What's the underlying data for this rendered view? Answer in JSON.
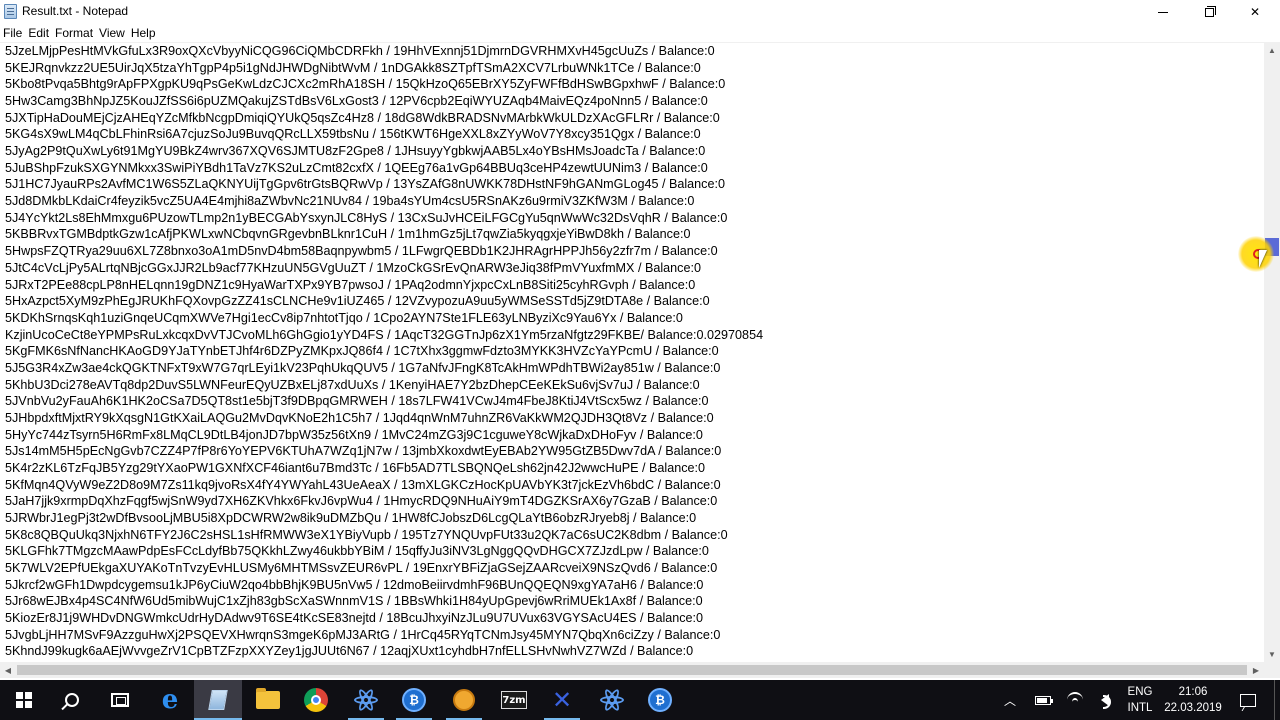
{
  "window": {
    "title": "Result.txt - Notepad"
  },
  "menu": [
    "File",
    "Edit",
    "Format",
    "View",
    "Help"
  ],
  "lines": [
    "5JzeLMjpPesHtMVkGfuLx3R9oxQXcVbyyNiCQG96CiQMbCDRFkh / 19HhVExnnj51DjmrnDGVRHMXvH45gcUuZs / Balance:0",
    "5KEJRqnvkzz2UE5UirJqX5tzaYhTgpP4p5i1gNdJHWDgNibtWvM / 1nDGAkk8SZTpfTSmA2XCV7LrbuWNk1TCe / Balance:0",
    "5Kbo8tPvqa5Bhtg9rApFPXgpKU9qPsGeKwLdzCJCXc2mRhA18SH / 15QkHzoQ65EBrXY5ZyFWFfBdHSwBGpxhwF / Balance:0",
    "5Hw3Camg3BhNpJZ5KouJZfSS6i6pUZMQakujZSTdBsV6LxGost3 / 12PV6cpb2EqiWYUZAqb4MaivEQz4poNnn5 / Balance:0",
    "5JXTipHaDouMEjCjzAHEqYZcMfkbNcgpDmiqiQYUkQ5qsZc4Hz8 / 18dG8WdkBRADSNvMArbkWkULDzXAcGFLRr / Balance:0",
    "5KG4sX9wLM4qCbLFhinRsi6A7cjuzSoJu9BuvqQRcLLX59tbsNu / 156tKWT6HgeXXL8xZYyWoV7Y8xcy351Qgx / Balance:0",
    "5JyAg2P9tQuXwLy6t91MgYU9BkZ4wrv367XQV6SJMTU8zF2Gpe8 / 1JHsuyyYgbkwjAAB5Lx4oYBsHMsJoadcTa / Balance:0",
    "5JuBShpFzukSXGYNMkxx3SwiPiYBdh1TaVz7KS2uLzCmt82cxfX / 1QEEg76a1vGp64BBUq3ceHP4zewtUUNim3 / Balance:0",
    "5J1HC7JyauRPs2AvfMC1W6S5ZLaQKNYUijTgGpv6trGtsBQRwVp / 13YsZAfG8nUWKK78DHstNF9hGANmGLog45 / Balance:0",
    "5Jd8DMkbLKdaiCr4feyzik5vcZ5UA4E4mjhi8aZWbvNc21NUv84 / 19ba4sYUm4csU5RSnAKz6u9rmiV3ZKfW3M / Balance:0",
    "5J4YcYkt2Ls8EhMmxgu6PUzowTLmp2n1yBECGAbYsxynJLC8HyS / 13CxSuJvHCEiLFGCgYu5qnWwWc32DsVqhR / Balance:0",
    "5KBBRvxTGMBdptkGzw1cAfjPKWLxwNCbqvnGRgevbnBLknr1CuH / 1m1hmGz5jLt7qwZia5kyqgxjeYiBwD8kh / Balance:0",
    "5HwpsFZQTRya29uu6XL7Z8bnxo3oA1mD5nvD4bm58Baqnpywbm5 / 1LFwgrQEBDb1K2JHRAgrHPPJh56y2zfr7m / Balance:0",
    "5JtC4cVcLjPy5ALrtqNBjcGGxJJR2Lb9acf77KHzuUN5GVgUuZT / 1MzoCkGSrEvQnARW3eJiq38fPmVYuxfmMX / Balance:0",
    "5JRxT2PEe88cpLP8nHELqnn19gDNZ1c9HyaWarTXPx9YB7pwsoJ / 1PAq2odmnYjxpcCxLnB8Siti25cyhRGvph / Balance:0",
    "5HxAzpct5XyM9zPhEgJRUKhFQXovpGzZZ41sCLNCHe9v1iUZ465 / 12VZvypozuA9uu5yWMSeSSTd5jZ9tDTA8e / Balance:0",
    "5KDKhSrnqsKqh1uziGnqeUCqmXWVe7Hgi1ecCv8ip7nhtotTjqo / 1Cpo2AYN7Ste1FLE63yLNByziXc9Yau6Yx / Balance:0",
    "KzjinUcoCeCt8eYPMPsRuLxkcqxDvVTJCvoMLh6GhGgio1yYD4FS / 1AqcT32GGTnJp6zX1Ym5rzaNfgtz29FKBE/ Balance:0.02970854",
    "5KgFMK6sNfNancHKAoGD9YJaTYnbETJhf4r6DZPyZMKpxJQ86f4 / 1C7tXhx3ggmwFdzto3MYKK3HVZcYaYPcmU / Balance:0",
    "5J5G3R4xZw3ae4ckQGKTNFxT9xW7G7qrLEyi1kV23PqhUkqQUV5 / 1G7aNfvJFngK8TcAkHmWPdhTBWi2ay851w / Balance:0",
    "5KhbU3Dci278eAVTq8dp2DuvS5LWNFeurEQyUZBxELj87xdUuXs / 1KenyiHAE7Y2bzDhepCEeKEkSu6vjSv7uJ / Balance:0",
    "5JVnbVu2yFauAh6K1HK2oCSa7D5QT8st1e5bjT3f9DBpqGMRWEH / 18s7LFW41VCwJ4m4FbeJ8KtiJ4VtScx5wz / Balance:0",
    "5JHbpdxftMjxtRY9kXqsgN1GtKXaiLAQGu2MvDqvKNoE2h1C5h7 / 1Jqd4qnWnM7uhnZR6VaKkWM2QJDH3Qt8Vz / Balance:0",
    "5HyYc744zTsyrn5H6RmFx8LMqCL9DtLB4jonJD7bpW35z56tXn9 / 1MvC24mZG3j9C1cguweY8cWjkaDxDHoFyv / Balance:0",
    "5Js14mM5H5pEcNgGvb7CZZ4P7fP8r6YoYEPV6KTUhA7WZq1jN7w / 13jmbXkoxdwtEyEBAb2YW95GtZB5Dwv7dA / Balance:0",
    "5K4r2zKL6TzFqJB5Yzg29tYXaoPW1GXNfXCF46iant6u7Bmd3Tc / 16Fb5AD7TLSBQNQeLsh62jn42J2wwcHuPE / Balance:0",
    "5KfMqn4QVyW9eZ2D8o9M7Zs11kq9jvoRsX4fY4YWYahL43UeAeaX / 13mXLGKCzHocKpUAVbYK3t7jckEzVh6bdC / Balance:0",
    "5JaH7jjk9xrmpDqXhzFqgf5wjSnW9yd7XH6ZKVhkx6FkvJ6vpWu4 / 1HmycRDQ9NHuAiY9mT4DGZKSrAX6y7GzaB / Balance:0",
    "5JRWbrJ1egPj3t2wDfBvsooLjMBU5i8XpDCWRW2w8ik9uDMZbQu / 1HW8fCJobszD6LcgQLaYtB6obzRJryeb8j / Balance:0",
    "5K8c8QBQuUkq3NjxhN6TFY2J6C2sHSL1sHfRMWW3eX1YBiyVupb / 195Tz7YNQUvpFUt33u2QK7aC6sUC2K8dbm / Balance:0",
    "5KLGFhk7TMgzcMAawPdpEsFCcLdyfBb75QKkhLZwy46ukbbYBiM / 15qffyJu3iNV3LgNggQQvDHGCX7ZJzdLpw / Balance:0",
    "5K7WLV2EPfUEkgaXUYAKoTnTvzyEvHLUSMy6MHTMSsvZEUR6vPL / 19EnxrYBFiZjaGSejZAARcveiX9NSzQvd6 / Balance:0",
    "5Jkrcf2wGFh1Dwpdcygemsu1kJP6yCiuW2qo4bbBhjK9BU5nVw5 / 12dmoBeiirvdmhF96BUnQQEQN9xgYA7aH6 / Balance:0",
    "5Jr68wEJBx4p4SC4NfW6Ud5mibWujC1xZjh83gbScXaSWnnmV1S / 1BBsWhki1H84yUpGpevj6wRriMUEk1Ax8f / Balance:0",
    "5KiozEr8J1j9WHDvDNGWmkcUdrHyDAdwv9T6SE4tKcSE83nejtd / 18BcuJhxyiNzJLu9U7UVux63VGYSAcU4ES / Balance:0",
    "5JvgbLjHH7MSvF9AzzguHwXj2PSQEVXHwrqnS3mgeK6pMJ3ARtG / 1HrCq45RYqTCNmJsy45MYN7QbqXn6ciZzy / Balance:0",
    "5KhndJ99kugk6aAEjWvvgeZrV1CpBTZFzpXXYZey1jgJUUt6N67 / 12aqjXUxt1cyhdbH7nfELLSHvNwhVZ7WZd / Balance:0"
  ],
  "taskbar": {
    "apps": [
      "start-icon",
      "search-icon",
      "task-view-icon",
      "edge-icon",
      "notepad-icon",
      "file-explorer-icon",
      "chrome-icon",
      "electrum-icon",
      "bitcoin-core-icon",
      "cookie-app-icon",
      "7zip-icon",
      "x-app-icon",
      "react-atom-icon",
      "wallet-icon"
    ],
    "zip_label": "7zm",
    "language": {
      "line1": "ENG",
      "line2": "INTL"
    },
    "clock": {
      "time": "21:06",
      "date": "22.03.2019"
    }
  },
  "colors": {
    "taskbar_bg": "#0f0f14",
    "scroll_thumb": "#5b6bd6",
    "cursor_highlight": "#ffd200"
  }
}
